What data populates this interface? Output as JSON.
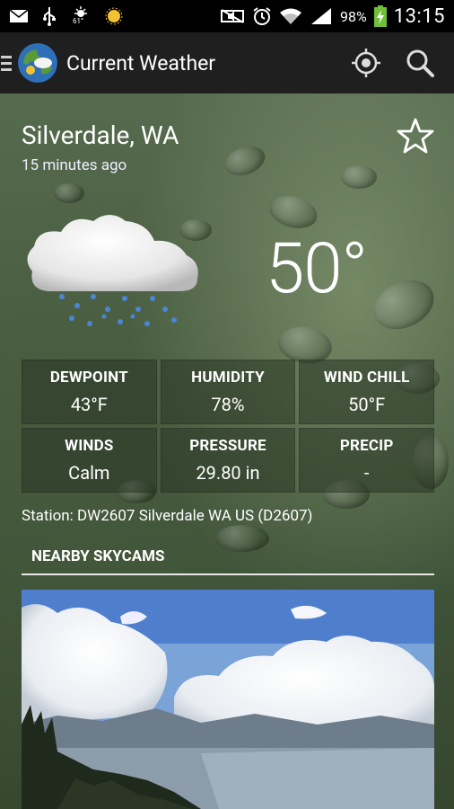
{
  "status_bar": {
    "icons_left": [
      "mail-icon",
      "usb-icon",
      "weather-notification-icon",
      "sun-icon"
    ],
    "notification_temp": "61°",
    "icons_right": [
      "mute-icon",
      "alarm-icon",
      "wifi-icon",
      "signal-icon",
      "battery-charging-icon"
    ],
    "battery": "98%",
    "time": "13:15"
  },
  "action_bar": {
    "title": "Current Weather",
    "actions": [
      "location-icon",
      "search-icon"
    ]
  },
  "location": {
    "city": "Silverdale, WA",
    "updated": "15 minutes ago"
  },
  "current": {
    "condition_icon": "cloud-rain-icon",
    "temperature": "50°"
  },
  "stats": [
    {
      "label": "DEWPOINT",
      "value": "43°F"
    },
    {
      "label": "HUMIDITY",
      "value": "78%"
    },
    {
      "label": "WIND CHILL",
      "value": "50°F"
    },
    {
      "label": "WINDS",
      "value": "Calm"
    },
    {
      "label": "PRESSURE",
      "value": "29.80 in"
    },
    {
      "label": "PRECIP",
      "value": "-"
    }
  ],
  "station": "Station: DW2607 Silverdale WA US (D2607)",
  "skycams": {
    "section_title": "NEARBY SKYCAMS"
  },
  "colors": {
    "action_bar": "#1f1f1f",
    "content_green": "#4a5e42",
    "battery_green": "#6fbf3a"
  }
}
